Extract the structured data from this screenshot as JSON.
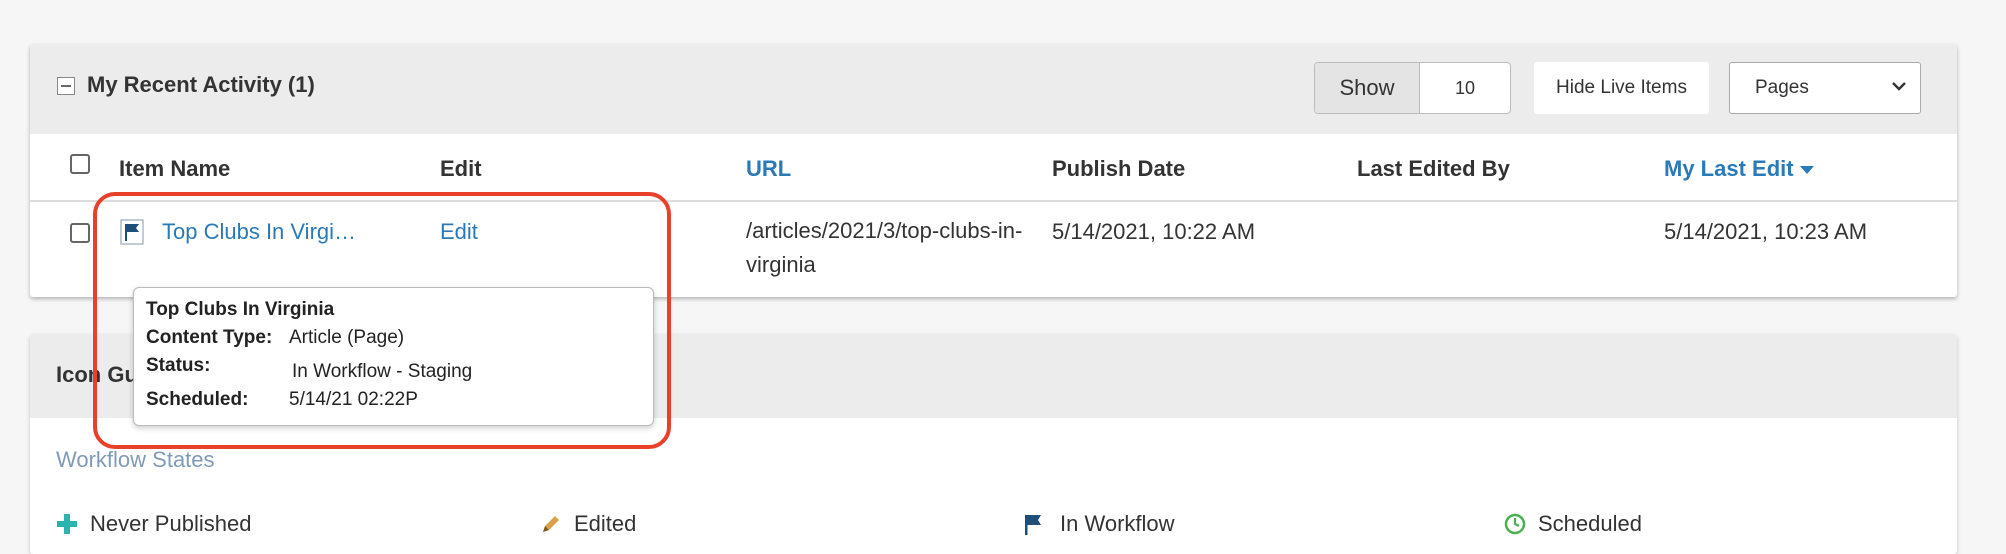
{
  "recent_activity": {
    "title": "My Recent Activity (1)",
    "show_label": "Show",
    "show_count": "10",
    "hide_live_label": "Hide Live Items",
    "type_select": "Pages",
    "columns": {
      "item_name": "Item Name",
      "edit": "Edit",
      "url": "URL",
      "publish_date": "Publish Date",
      "last_edited_by": "Last Edited By",
      "my_last_edit": "My Last Edit"
    },
    "rows": [
      {
        "item_name": "Top Clubs In Virgi…",
        "edit": "Edit",
        "url": "/articles/2021/3/top-clubs-in-virginia",
        "publish_date": "5/14/2021, 10:22 AM",
        "last_edited_by": "",
        "my_last_edit": "5/14/2021, 10:23 AM"
      }
    ]
  },
  "tooltip": {
    "title": "Top Clubs In Virginia",
    "content_type_label": "Content Type:",
    "content_type": "Article (Page)",
    "status_label": "Status:",
    "status": "In Workflow - Staging",
    "scheduled_label": "Scheduled:",
    "scheduled": "5/14/21 02:22P"
  },
  "icon_guide": {
    "title": "Icon Gu",
    "section": "Workflow States",
    "items": [
      {
        "label": "Never Published",
        "icon": "plus-icon",
        "color": "#2bb3b0"
      },
      {
        "label": "Edited",
        "icon": "pencil-icon",
        "color": "#d9a24a"
      },
      {
        "label": "In Workflow",
        "icon": "flag-icon",
        "color": "#1f4f79"
      },
      {
        "label": "Scheduled",
        "icon": "clock-icon",
        "color": "#4caf50"
      }
    ]
  },
  "colors": {
    "link": "#2a7ab8",
    "highlight": "#e8402a"
  }
}
